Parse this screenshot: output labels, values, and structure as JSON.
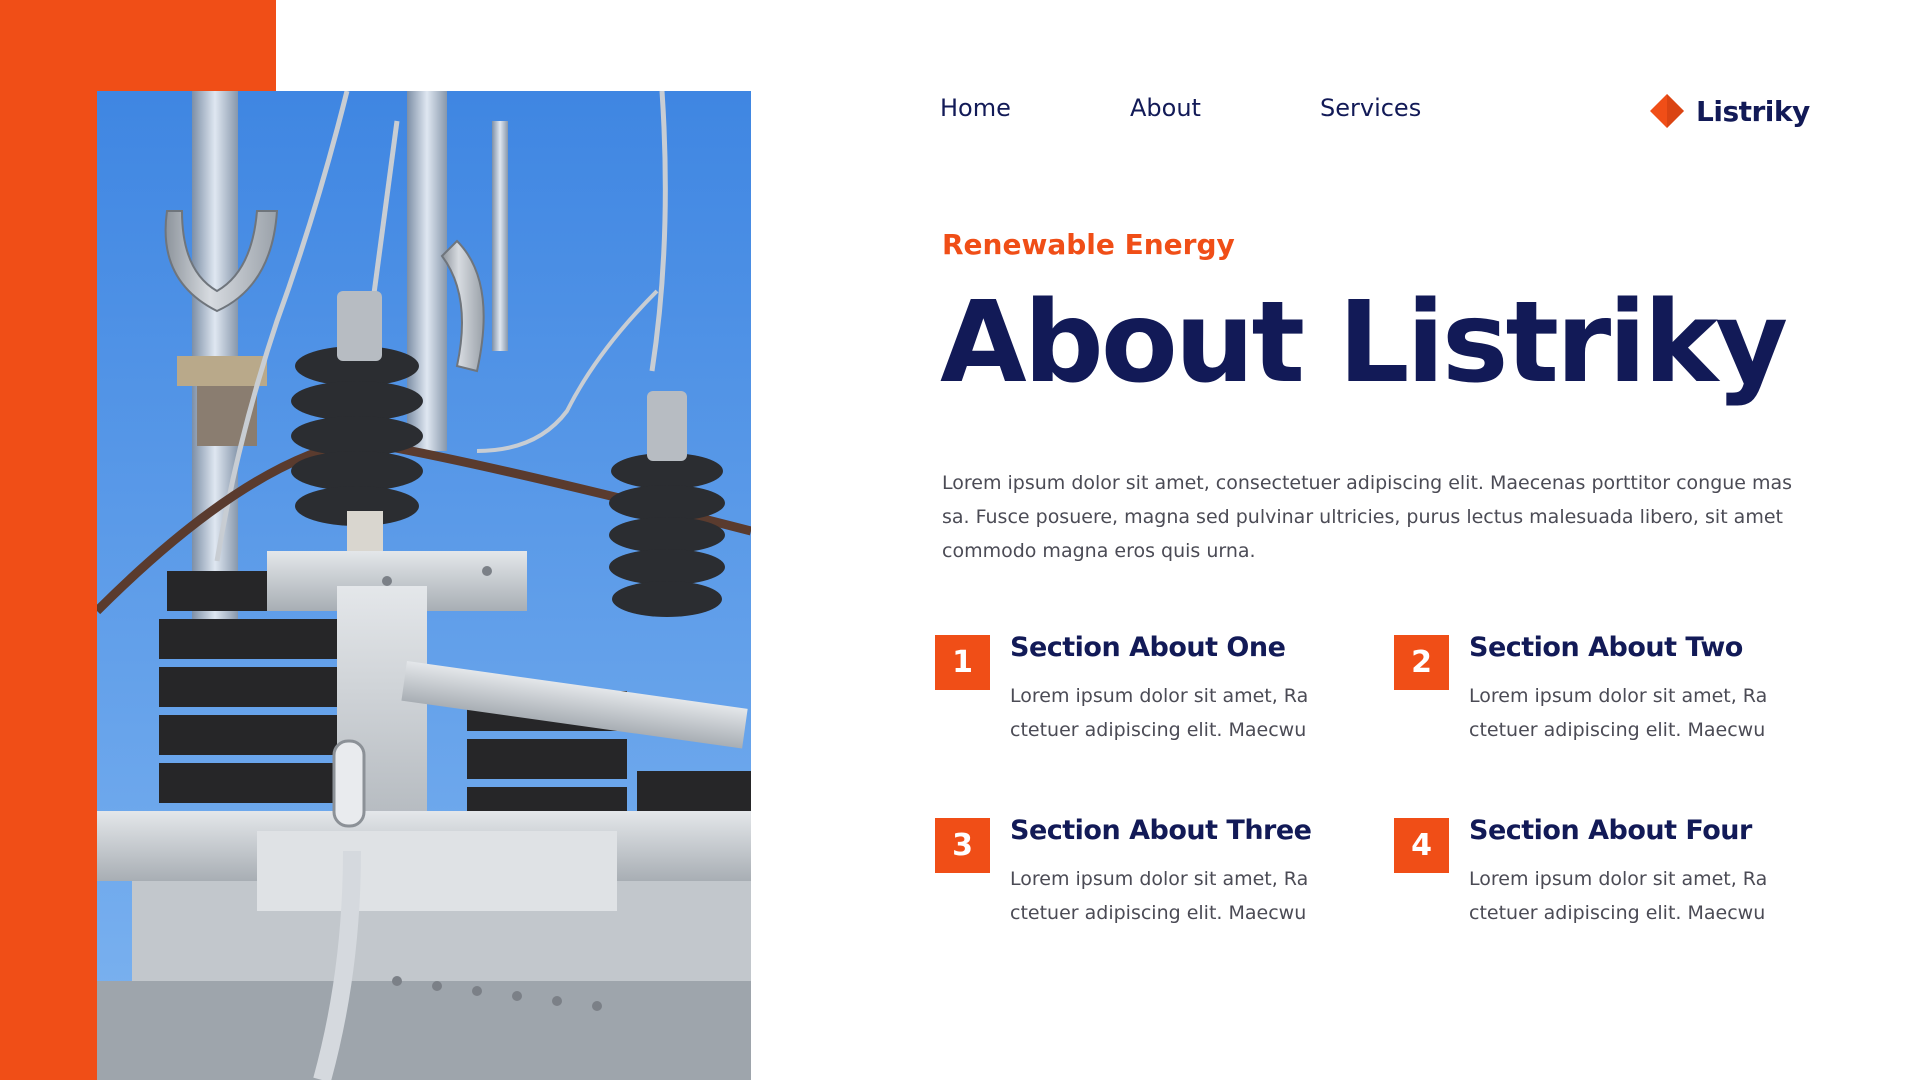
{
  "colors": {
    "accent": "#f04e17",
    "navy": "#121a57",
    "body_text": "#4b4b55",
    "sky": "#4a8fe3"
  },
  "nav": {
    "items": [
      {
        "label": "Home"
      },
      {
        "label": "About"
      },
      {
        "label": "Services"
      }
    ]
  },
  "brand": {
    "name": "Listriky",
    "icon": "diamond-logo-icon"
  },
  "hero": {
    "eyebrow": "Renewable Energy",
    "title": "About Listriky",
    "body": "Lorem ipsum dolor sit amet, consectetuer adipiscing elit. Maecenas porttitor congue mas sa. Fusce posuere, magna sed pulvinar ultricies, purus lectus malesuada libero, sit amet commodo magna eros quis urna."
  },
  "sections": [
    {
      "number": "1",
      "title": "Section About One",
      "text": "Lorem ipsum dolor sit amet, Ra ctetuer adipiscing elit. Maecwu"
    },
    {
      "number": "2",
      "title": "Section About Two",
      "text": "Lorem ipsum dolor sit amet, Ra ctetuer adipiscing elit. Maecwu"
    },
    {
      "number": "3",
      "title": "Section About Three",
      "text": "Lorem ipsum dolor sit amet, Ra ctetuer adipiscing elit. Maecwu"
    },
    {
      "number": "4",
      "title": "Section About Four",
      "text": "Lorem ipsum dolor sit amet, Ra ctetuer adipiscing elit. Maecwu"
    }
  ],
  "photo": {
    "subject": "electrical-substation-photo"
  }
}
